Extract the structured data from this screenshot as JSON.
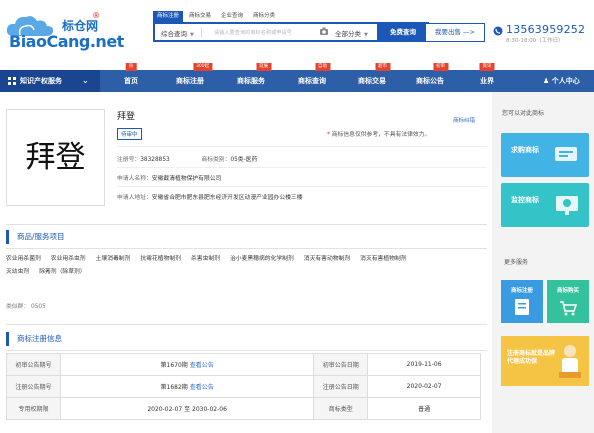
{
  "logo": {
    "cn": "标仓网",
    "reg": "®",
    "en": "BiaoCang.net"
  },
  "search_tabs": [
    "商标注册",
    "商标交易",
    "企业查询",
    "商标分类"
  ],
  "search": {
    "mode": "综合查询",
    "placeholder": "请输入要查询的商标名称或申请号",
    "category": "全部分类",
    "button": "免费查询"
  },
  "sell_button": "我要出售 —>",
  "contact": {
    "phone": "13563959252",
    "hours": "8:30-18:00（工作日）"
  },
  "nav": {
    "first": "知识产权服务",
    "items": [
      {
        "label": "首页",
        "badge": "热"
      },
      {
        "label": "商标注册",
        "badge": "300起"
      },
      {
        "label": "商标服务",
        "badge": "延展"
      },
      {
        "label": "商标查询",
        "badge": "自助"
      },
      {
        "label": "商标交易",
        "badge": "超市"
      },
      {
        "label": "商标公告",
        "badge": "初审"
      },
      {
        "label": "业界",
        "badge": "资讯"
      }
    ],
    "personal": "个人中心"
  },
  "trademark": {
    "image_text": "拜登",
    "name": "拜登",
    "report": "商标纠错",
    "status": "待审中",
    "disclaimer_star": "*",
    "disclaimer": "商标信息仅供参考，不具有法律效力。",
    "reg_label": "注册号：",
    "reg_no": "38328853",
    "class_label": "商标类别：",
    "class": "05类-医药",
    "applicant_label": "申请人名称：",
    "applicant": "安徽截清植物保护有限公司",
    "address_label": "申请人地址：",
    "address": "安徽省合肥市肥东县肥东经济开发区动漫产业园办公楼三楼"
  },
  "goods_section": {
    "title": "商品/服务项目",
    "items": [
      "农业用杀菌剂",
      "农业用杀虫剂",
      "土壤消毒制剂",
      "抗霉花植物制剂",
      "杀害虫制剂",
      "治小麦黑穗病的化学制剂",
      "消灭有害动物制剂",
      "消灭有害植物制剂",
      "灭幼虫剂",
      "除莠剂（除草剂）"
    ],
    "class_label": "类似群：",
    "class_value": "0505"
  },
  "reg_section": {
    "title": "商标注册信息",
    "rows": [
      {
        "l1": "初审公告期号",
        "v1": "第1670期",
        "link1": "查看公告",
        "l2": "初审公告日期",
        "v2": "2019-11-06"
      },
      {
        "l1": "注册公告期号",
        "v1": "第1682期",
        "link1": "查看公告",
        "l2": "注册公告日期",
        "v2": "2020-02-07"
      },
      {
        "l1": "专用权期限",
        "v1": "2020-02-07 至 2030-02-06",
        "link1": "",
        "l2": "商标类型",
        "v2": "普通"
      }
    ]
  },
  "sidebar": {
    "title": "您可以对此商标",
    "cards": [
      {
        "label": "求购商标",
        "color": "#41b3e4"
      },
      {
        "label": "监控商标",
        "color": "#34c3c6"
      }
    ],
    "more_title": "更多服务",
    "services": [
      {
        "label": "商标注册",
        "color": "#3a9be3"
      },
      {
        "label": "商标购买",
        "color": "#33c29c"
      }
    ],
    "promo": "注册商标就是品牌代理成功保"
  }
}
